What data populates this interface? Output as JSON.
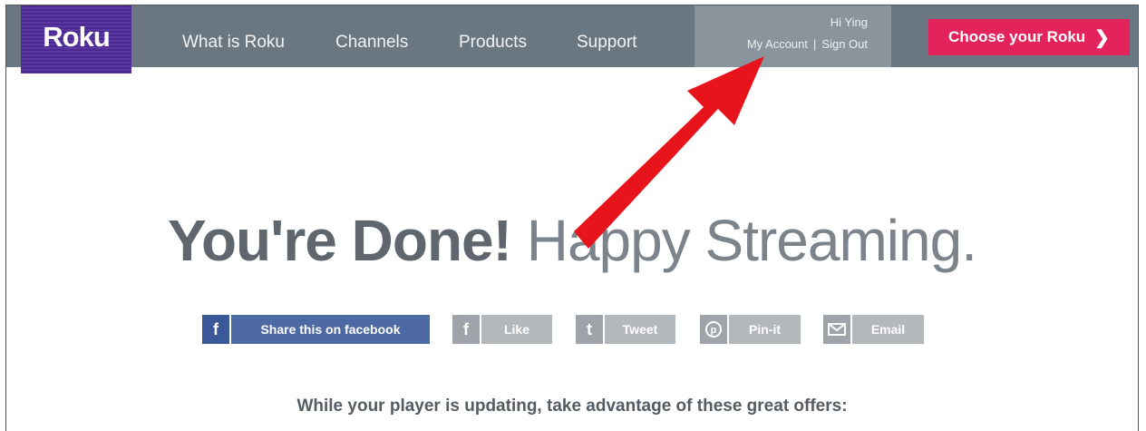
{
  "brand": {
    "logo_text": "Roku"
  },
  "nav": {
    "items": [
      "What is Roku",
      "Channels",
      "Products",
      "Support"
    ]
  },
  "account": {
    "greeting": "Hi Ying",
    "my_account": "My Account",
    "separator": "|",
    "sign_out": "Sign Out"
  },
  "cta": {
    "label": "Choose your Roku",
    "icon": "chevron-right-icon"
  },
  "hero": {
    "bold": "You're Done!",
    "light": "Happy Streaming."
  },
  "share": {
    "facebook_share": "Share this on facebook",
    "like": "Like",
    "tweet": "Tweet",
    "pin": "Pin-it",
    "email": "Email"
  },
  "offers_text": "While your player is updating, take advantage of these great offers:",
  "colors": {
    "nav_bg": "#6b7780",
    "brand_purple": "#4b2a8f",
    "cta_red": "#e3245c",
    "annotation_arrow": "#e8141b"
  }
}
